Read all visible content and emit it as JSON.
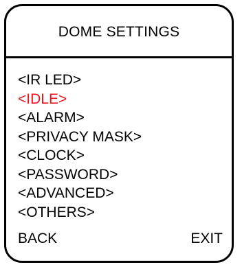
{
  "title": "DOME SETTINGS",
  "colors": {
    "selected": "#e8141b",
    "text": "#000000",
    "border": "#000000",
    "background": "#ffffff"
  },
  "menu": {
    "selected_index": 1,
    "items": [
      {
        "label": "<IR LED>"
      },
      {
        "label": "<IDLE>"
      },
      {
        "label": "<ALARM>"
      },
      {
        "label": "<PRIVACY MASK>"
      },
      {
        "label": "<CLOCK>"
      },
      {
        "label": "<PASSWORD>"
      },
      {
        "label": "<ADVANCED>"
      },
      {
        "label": "<OTHERS>"
      }
    ]
  },
  "footer": {
    "back_label": "BACK",
    "exit_label": "EXIT"
  }
}
